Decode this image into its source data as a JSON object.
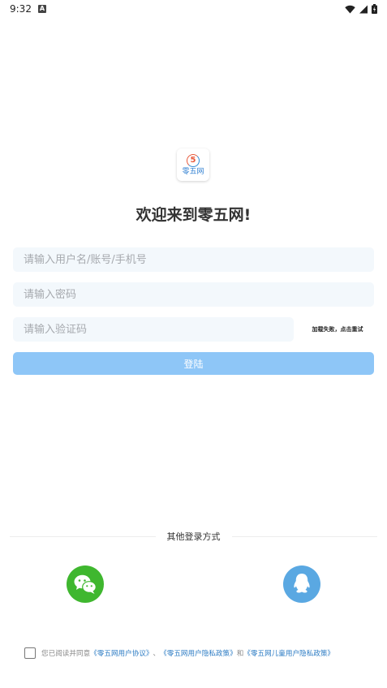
{
  "status_bar": {
    "time": "9:32",
    "notification_badge": "A",
    "icons": [
      "wifi-icon",
      "signal-icon",
      "battery-icon"
    ]
  },
  "logo": {
    "number": "5",
    "text": "零五网"
  },
  "welcome_text": "欢迎来到零五网!",
  "form": {
    "username_placeholder": "请输入用户名/账号/手机号",
    "password_placeholder": "请输入密码",
    "captcha_placeholder": "请输入验证码",
    "captcha_error": "加载失败，点击重试",
    "login_label": "登陆"
  },
  "other_login": {
    "label": "其他登录方式",
    "methods": [
      "wechat-icon",
      "qq-icon"
    ]
  },
  "agreement": {
    "prefix": "您已阅读并同意",
    "user_agreement": "《零五网用户协议》",
    "sep1": "、",
    "privacy_policy": "《零五网用户隐私政策》",
    "and": "和",
    "child_privacy": "《零五网儿童用户隐私政策》"
  },
  "colors": {
    "primary_button": "#8ec6f7",
    "input_background": "#f3f8fc",
    "wechat": "#3fb72f",
    "qq": "#5aa8e2",
    "link": "#2d7cc4"
  }
}
